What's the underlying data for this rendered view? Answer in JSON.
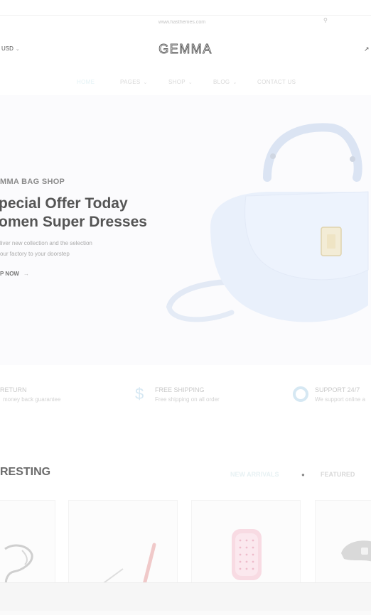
{
  "search": {
    "placeholder": "www.hasthemes.com"
  },
  "header": {
    "currency": "USD",
    "logo_text": "GEMMA"
  },
  "nav": {
    "items": [
      {
        "label": "HOME",
        "active": true,
        "has_dropdown": false
      },
      {
        "label": "PAGES",
        "active": false,
        "has_dropdown": true
      },
      {
        "label": "SHOP",
        "active": false,
        "has_dropdown": true
      },
      {
        "label": "BLOG",
        "active": false,
        "has_dropdown": true
      },
      {
        "label": "CONTACT US",
        "active": false,
        "has_dropdown": false
      }
    ]
  },
  "hero": {
    "brand": "MMA BAG SHOP",
    "title_line1": "pecial Offer Today",
    "title_line2": "omen Super Dresses",
    "desc_line1": "liver new collection and the selection",
    "desc_line2": "our factory to your doorstep",
    "cta_label": "P NOW"
  },
  "features": [
    {
      "title": "RETURN",
      "desc": "money back guarantee",
      "icon": "return-icon"
    },
    {
      "title": "FREE SHIPPING",
      "desc": "Free shipping on all order",
      "icon": "dollar-icon"
    },
    {
      "title": "SUPPORT 24/7",
      "desc": "We support online a",
      "icon": "lifebuoy-icon"
    }
  ],
  "section": {
    "title": "RESTING",
    "tabs": [
      {
        "label": "NEW ARRIVALS",
        "active": true
      },
      {
        "label": "FEATURED",
        "active": false
      }
    ]
  },
  "colors": {
    "accent": "#e3f2f5",
    "hero_bg": "#fbfbfd",
    "bag": "#e9f0fb"
  }
}
